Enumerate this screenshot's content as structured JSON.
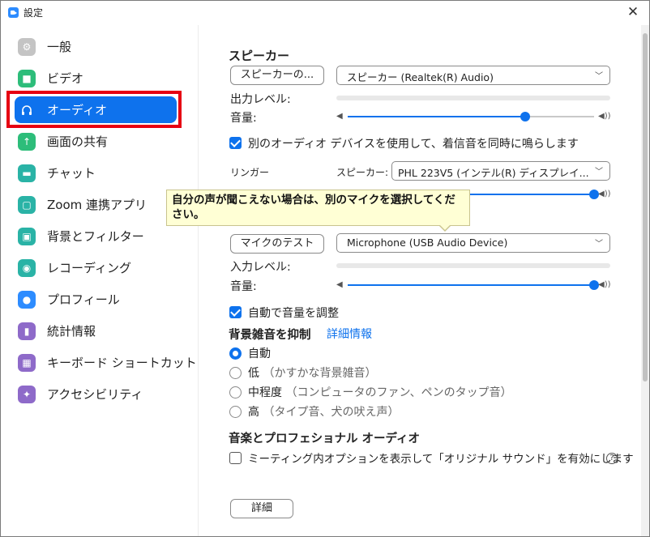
{
  "window": {
    "title": "設定"
  },
  "sidebar": {
    "items": [
      {
        "label": "一般",
        "icon": "gear-icon",
        "color": "#b8b8b8"
      },
      {
        "label": "ビデオ",
        "icon": "video-camera-icon",
        "color": "#2dbd7a"
      },
      {
        "label": "オーディオ",
        "icon": "headphones-icon",
        "color": "#0e72ed",
        "active": true
      },
      {
        "label": "画面の共有",
        "icon": "share-screen-icon",
        "color": "#2dbd7a"
      },
      {
        "label": "チャット",
        "icon": "chat-bubble-icon",
        "color": "#2ab3a6"
      },
      {
        "label": "Zoom 連携アプリ",
        "icon": "apps-icon",
        "color": "#2ab3a6"
      },
      {
        "label": "背景とフィルター",
        "icon": "background-person-icon",
        "color": "#2ab3a6"
      },
      {
        "label": "レコーディング",
        "icon": "record-icon",
        "color": "#2ab3a6"
      },
      {
        "label": "プロフィール",
        "icon": "profile-icon",
        "color": "#2d8cff"
      },
      {
        "label": "統計情報",
        "icon": "statistics-icon",
        "color": "#8e6ac9"
      },
      {
        "label": "キーボード ショートカット",
        "icon": "keyboard-icon",
        "color": "#8e6ac9"
      },
      {
        "label": "アクセシビリティ",
        "icon": "accessibility-icon",
        "color": "#8e6ac9"
      }
    ]
  },
  "speaker": {
    "heading": "スピーカー",
    "test_button": "スピーカーの...",
    "device": "スピーカー (Realtek(R) Audio)",
    "output_level_label": "出力レベル:",
    "volume_label": "音量:",
    "volume_level": 0.72
  },
  "separate_device": {
    "checked": true,
    "label": "別のオーディオ デバイスを使用して、着信音を同時に鳴らします"
  },
  "ringer": {
    "label": "リンガー",
    "speaker_label": "スピーカー:",
    "device": "PHL 223V5 (インテル(R) ディスプレイ...",
    "volume_level": 1.0
  },
  "tooltip": {
    "text": "自分の声が聞こえない場合は、別のマイクを選択してください。"
  },
  "microphone": {
    "test_button": "マイクのテスト",
    "device": "Microphone (USB Audio Device)",
    "input_level_label": "入力レベル:",
    "volume_label": "音量:",
    "volume_level": 1.0
  },
  "auto_adjust": {
    "checked": true,
    "label": "自動で音量を調整"
  },
  "noise_suppression": {
    "heading": "背景雑音を抑制",
    "more_link": "詳細情報",
    "options": [
      {
        "label": "自動",
        "note": "",
        "selected": true
      },
      {
        "label": "低",
        "note": "（かすかな背景雑音）",
        "selected": false
      },
      {
        "label": "中程度",
        "note": "（コンピュータのファン、ペンのタップ音）",
        "selected": false
      },
      {
        "label": "高",
        "note": "（タイプ音、犬の吠え声）",
        "selected": false
      }
    ]
  },
  "music": {
    "heading": "音楽とプロフェショナル オーディオ",
    "original_sound_checked": false,
    "original_sound_label": "ミーティング内オプションを表示して「オリジナル サウンド」を有効にします",
    "help_icon": "?"
  },
  "advanced_button": "詳細"
}
